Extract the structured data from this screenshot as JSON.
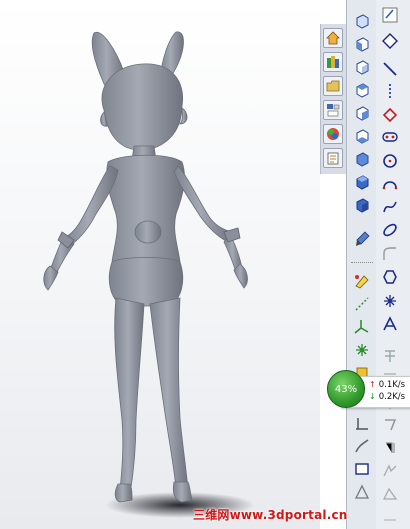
{
  "model": {
    "description_icon": "3d-figure"
  },
  "task_pane": {
    "buttons": [
      {
        "icon": "home-icon",
        "color": "#f0b040"
      },
      {
        "icon": "design-library-icon",
        "color": "#3a9a3a"
      },
      {
        "icon": "file-explorer-icon",
        "color": "#e4c25a"
      },
      {
        "icon": "view-palette-icon",
        "color": "#4466aa"
      },
      {
        "icon": "appearances-icon",
        "color": "#e04a2a"
      },
      {
        "icon": "custom-properties-icon",
        "color": "#b08040"
      }
    ]
  },
  "views_toolbar": {
    "buttons": [
      "normal-to-icon",
      "front-view-icon",
      "back-view-icon",
      "left-view-icon",
      "right-view-icon",
      "top-view-icon",
      "bottom-view-icon",
      "isometric-view-icon",
      "trimetric-view-icon",
      "dimetric-view-icon",
      "appearance-brush-icon",
      "edit-appearance-icon",
      "reference-line-icon",
      "coordinate-system-icon",
      "point-icon",
      "center-of-mass-icon",
      "split-line-icon",
      "curve-icon",
      "view-flag-icon"
    ]
  },
  "sketch_toolbar": {
    "buttons": [
      "sketch-icon",
      "smart-dimension-icon",
      "line-icon",
      "rectangle-icon",
      "slot-icon",
      "circle-icon",
      "arc-icon",
      "spline-icon",
      "ellipse-icon",
      "fillet-icon",
      "polygon-icon",
      "point-icon",
      "text-icon",
      "construction-icon",
      "offset-icon",
      "mirror-icon",
      "trim-icon",
      "extend-icon",
      "convert-icon",
      "display-relations-icon",
      "rapid-sketch-icon"
    ]
  },
  "net_monitor": {
    "percent": "43%",
    "up_rate": "0.1K/s",
    "down_rate": "0.2K/s",
    "up_arrow": "↑",
    "down_arrow": "↓",
    "color": "#2f9a2a"
  },
  "watermark": {
    "text": "三维网www.3dportal.cn",
    "color": "#d21717"
  }
}
